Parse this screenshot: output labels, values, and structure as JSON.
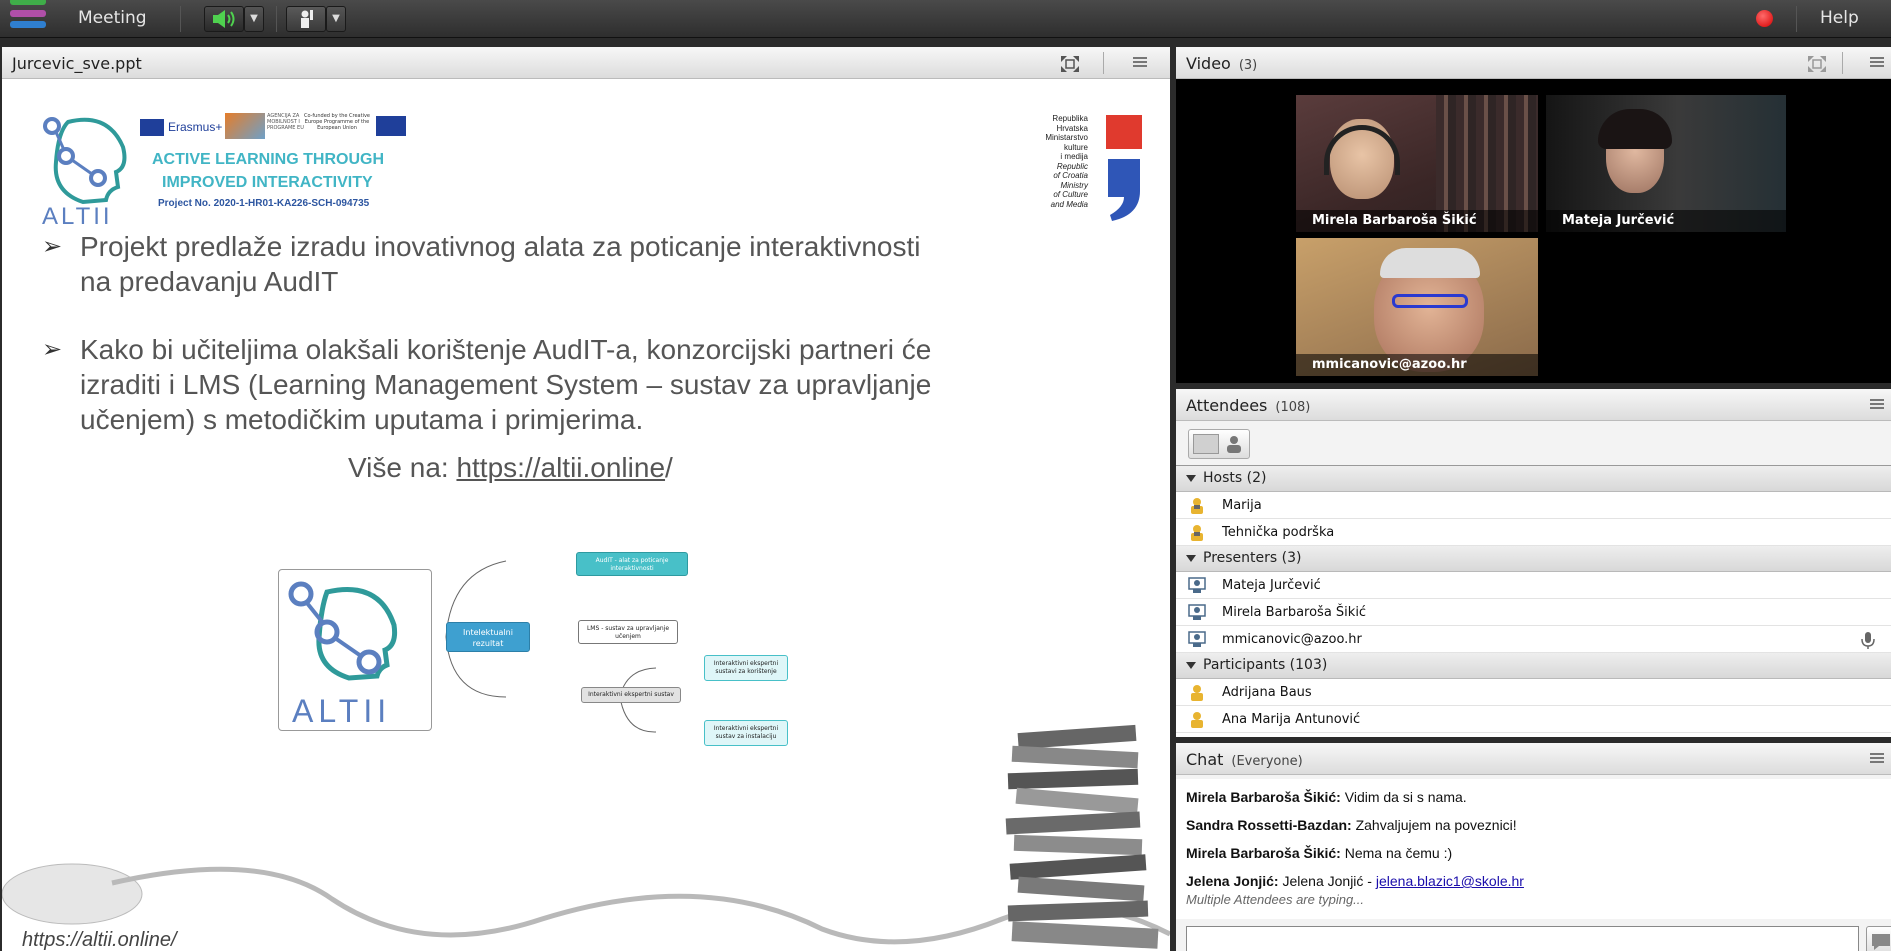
{
  "topbar": {
    "menu_meeting": "Meeting",
    "menu_help": "Help",
    "record_color": "#d40000"
  },
  "share_pod": {
    "title": "Jurcevic_sve.ppt",
    "slide": {
      "logo": {
        "erasmus": "Erasmus+",
        "agency": "AGENCIJA ZA MOBILNOST I PROGRAME EU",
        "eu_cofunded": "Co-funded by the Creative Europe Programme of the European Union",
        "altii": "ALTII",
        "project_line1": "ACTIVE LEARNING THROUGH",
        "project_line2": "IMPROVED INTERACTIVITY",
        "project_no": "Project No. 2020-1-HR01-KA226-SCH-094735"
      },
      "ministry_lines": [
        "Republika",
        "Hrvatska",
        "Ministarstvo",
        "kulture",
        "i medija",
        "Republic",
        "of Croatia",
        "Ministry",
        "of Culture",
        "and Media"
      ],
      "bullets": [
        {
          "line1": "Projekt predlaže izradu inovativnog alata za poticanje interaktivnosti",
          "line2": "na predavanju AudIT"
        },
        {
          "line1": "Kako bi učiteljima olakšali korištenje AudIT-a, konzorcijski partneri će",
          "line2": "izraditi i LMS (Learning Management System – sustav za upravljanje",
          "line3": "učenjem) s metodičkim uputama i primjerima."
        }
      ],
      "more_label": "Više na: ",
      "more_link": "https://altii.online",
      "more_slash": "/",
      "footer_url": "https://altii.online/",
      "diagram": {
        "center": "Intelektualni rezultat",
        "nodes": [
          "AudIT - alat za poticanje interaktivnosti",
          "LMS - sustav za upravljanje učenjem",
          "Interaktivni ekspertni sustav",
          "Interaktivni ekspertni sustavi za korištenje",
          "Interaktivni ekspertni sustav za instalaciju"
        ]
      }
    }
  },
  "video_pod": {
    "title": "Video",
    "count": "(3)",
    "tiles": [
      {
        "name": "Mirela Barbaroša Šikić"
      },
      {
        "name": "Mateja Jurčević"
      },
      {
        "name": "mmicanovic@azoo.hr"
      }
    ]
  },
  "attendees_pod": {
    "title": "Attendees",
    "count": "(108)",
    "groups": {
      "hosts": {
        "label": "Hosts (2)",
        "members": [
          "Marija",
          "Tehnička podrška"
        ]
      },
      "presenters": {
        "label": "Presenters (3)",
        "members": [
          "Mateja Jurčević",
          "Mirela Barbaroša Šikić",
          "mmicanovic@azoo.hr"
        ]
      },
      "participants": {
        "label": "Participants (103)",
        "members": [
          "Adrijana Baus",
          "Ana Marija Antunović"
        ]
      }
    }
  },
  "chat_pod": {
    "title": "Chat",
    "scope": "(Everyone)",
    "messages": [
      {
        "sender": "Mirela Barbaroša Šikić:",
        "text": " Vidim da si s nama."
      },
      {
        "sender": "Sandra Rossetti-Bazdan:",
        "text": " Zahvaljujem na poveznici!"
      },
      {
        "sender": "Mirela Barbaroša Šikić:",
        "text": " Nema na čemu :)"
      },
      {
        "sender": "Jelena Jonjić:",
        "text": " Jelena Jonjić - ",
        "link": "jelena.blazic1@skole.hr"
      }
    ],
    "typing": "Multiple Attendees are typing..."
  }
}
